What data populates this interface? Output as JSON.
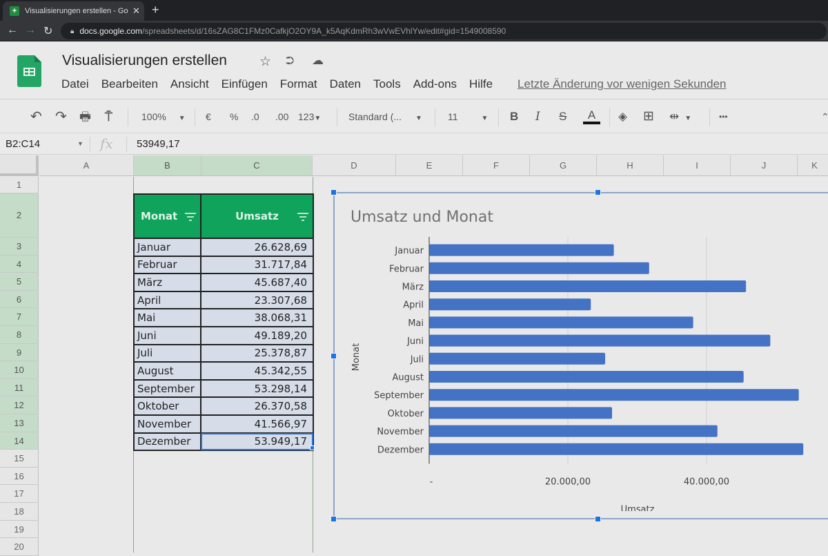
{
  "browser": {
    "tab_title": "Visualisierungen erstellen - Goog",
    "url_host": "docs.google.com",
    "url_path": "/spreadsheets/d/16sZAG8C1FMz0CafkjO2OY9A_k5AqKdmRh3wVwEVhlYw/edit#gid=1549008590"
  },
  "app": {
    "doc_title": "Visualisierungen erstellen",
    "menu": [
      "Datei",
      "Bearbeiten",
      "Ansicht",
      "Einfügen",
      "Format",
      "Daten",
      "Tools",
      "Add-ons",
      "Hilfe"
    ],
    "last_edit": "Letzte Änderung vor wenigen Sekunden"
  },
  "toolbar": {
    "zoom": "100%",
    "currency": "€",
    "percent": "%",
    "dec_decrease": ".0",
    "dec_increase": ".00",
    "number_format": "123",
    "font": "Standard (...",
    "font_size": "11",
    "bold": "B",
    "italic": "I",
    "strike": "S",
    "text_color": "A",
    "more": "•••"
  },
  "formula_bar": {
    "name_box": "B2:C14",
    "fx": "fx",
    "value": "53949,17"
  },
  "grid": {
    "columns": [
      "A",
      "B",
      "C",
      "D",
      "E",
      "F",
      "G",
      "H",
      "I",
      "J",
      "K"
    ],
    "rows": [
      "1",
      "2",
      "3",
      "4",
      "5",
      "6",
      "7",
      "8",
      "9",
      "10",
      "11",
      "12",
      "13",
      "14",
      "15",
      "16",
      "17",
      "18",
      "19",
      "20"
    ]
  },
  "table": {
    "headers": [
      "Monat",
      "Umsatz"
    ],
    "rows": [
      {
        "monat": "Januar",
        "umsatz": "26.628,69"
      },
      {
        "monat": "Februar",
        "umsatz": "31.717,84"
      },
      {
        "monat": "März",
        "umsatz": "45.687,40"
      },
      {
        "monat": "April",
        "umsatz": "23.307,68"
      },
      {
        "monat": "Mai",
        "umsatz": "38.068,31"
      },
      {
        "monat": "Juni",
        "umsatz": "49.189,20"
      },
      {
        "monat": "Juli",
        "umsatz": "25.378,87"
      },
      {
        "monat": "August",
        "umsatz": "45.342,55"
      },
      {
        "monat": "September",
        "umsatz": "53.298,14"
      },
      {
        "monat": "Oktober",
        "umsatz": "26.370,58"
      },
      {
        "monat": "November",
        "umsatz": "41.566,97"
      },
      {
        "monat": "Dezember",
        "umsatz": "53.949,17"
      }
    ]
  },
  "colors": {
    "header_green": "#0fa35c",
    "bar_blue": "#4472c4",
    "selection_blue": "#1a73e8"
  },
  "chart_data": {
    "type": "bar",
    "orientation": "horizontal",
    "title": "Umsatz und Monat",
    "xlabel": "Umsatz",
    "ylabel": "Monat",
    "categories": [
      "Januar",
      "Februar",
      "März",
      "April",
      "Mai",
      "Juni",
      "Juli",
      "August",
      "September",
      "Oktober",
      "November",
      "Dezember"
    ],
    "values": [
      26628.69,
      31717.84,
      45687.4,
      23307.68,
      38068.31,
      49189.2,
      25378.87,
      45342.55,
      53298.14,
      26370.58,
      41566.97,
      53949.17
    ],
    "xlim": [
      0,
      60000
    ],
    "xticks": [
      0,
      20000,
      40000
    ],
    "xtick_labels": [
      "-",
      "20.000,00",
      "40.000,00"
    ],
    "grid": true,
    "legend": "none"
  }
}
